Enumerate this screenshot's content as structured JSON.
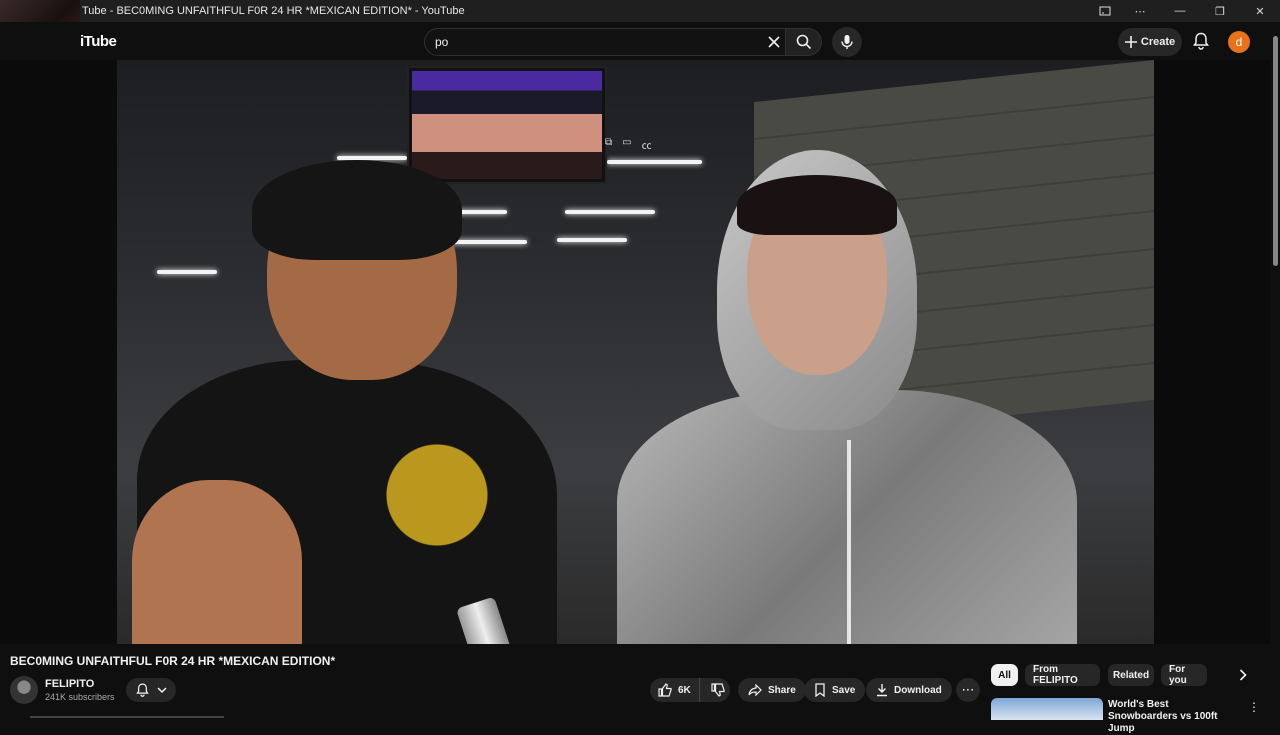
{
  "window": {
    "title": "Tube - BEC0MING UNFAITHFUL F0R 24 HR *MEXICAN EDITION* - YouTube",
    "controls": {
      "cast": "cast-icon",
      "menu": "⋯",
      "minimize": "—",
      "restore": "❐",
      "close": "✕"
    }
  },
  "masthead": {
    "logo_text": "iTube",
    "search": {
      "value": "po",
      "placeholder": "Search"
    },
    "create_label": "Create",
    "account_initial": "d",
    "colors": {
      "account_avatar": "#e8711a"
    }
  },
  "player": {
    "overlay_icons": [
      "miniplayer-icon",
      "theater-icon",
      "subtitles-icon"
    ]
  },
  "video": {
    "title": "BEC0MING UNFAITHFUL F0R 24 HR *MEXICAN EDITION*",
    "channel_name": "FELIPITO",
    "subscribers": "241K subscribers",
    "likes": "6K",
    "actions": {
      "share": "Share",
      "save": "Save",
      "download": "Download"
    }
  },
  "chips": [
    {
      "label": "All",
      "active": true
    },
    {
      "label": "From FELIPITO",
      "active": false
    },
    {
      "label": "Related",
      "active": false
    },
    {
      "label": "For you",
      "active": false
    }
  ],
  "recommendation": {
    "title": "World's Best Snowboarders vs 100ft Jump"
  }
}
